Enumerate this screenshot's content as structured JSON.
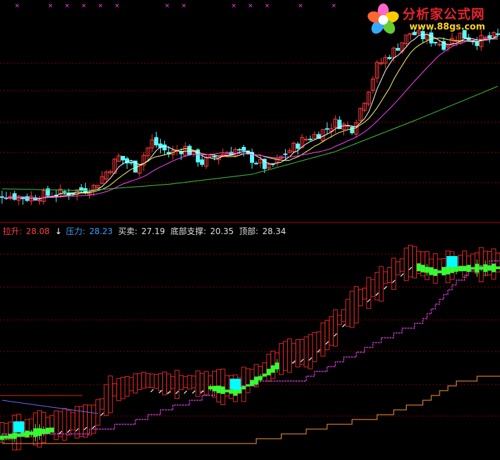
{
  "watermark": {
    "brand": "分析家公式网",
    "url": "www.88gs.com"
  },
  "indicator_legend": [
    {
      "label": "拉升:",
      "value": "28.08",
      "color": "#ff4040"
    },
    {
      "label": "压力:",
      "value": "28.23",
      "color": "#3aa0ff"
    },
    {
      "label": "买卖:",
      "value": "27.19",
      "color": "#e0e0e0"
    },
    {
      "label": "底部支撑:",
      "value": "20.35",
      "color": "#e0e0e0"
    },
    {
      "label": "顶部:",
      "value": "28.34",
      "color": "#e0e0e0"
    }
  ],
  "colors": {
    "background": "#000000",
    "grid": "#8b0000",
    "divider": "#c00000",
    "up_candle": "#ff3b3b",
    "down_candle": "#54ffff",
    "ma_short": "#ffffff",
    "ma_mid": "#ffff66",
    "ma_long": "#ff44ff",
    "ma_xlong": "#3cc83c",
    "band_red": "#e02828",
    "bull_block": "#33ff33",
    "cyan_block": "#00ffff",
    "support_line": "#e040e0",
    "bottom_line": "#ff9933",
    "marker_magenta": "#ff44ff"
  },
  "chart_data": [
    {
      "type": "candlestick",
      "title": "",
      "xlabel": "",
      "ylabel": "",
      "grid": true,
      "count": 120,
      "close_path": [
        [
          0,
          10.7
        ],
        [
          6,
          10.3
        ],
        [
          10,
          10.6
        ],
        [
          16,
          10.9
        ],
        [
          22,
          11.5
        ],
        [
          28,
          14.8
        ],
        [
          32,
          13.6
        ],
        [
          36,
          16.5
        ],
        [
          40,
          15.2
        ],
        [
          44,
          15.8
        ],
        [
          48,
          14.2
        ],
        [
          52,
          15.0
        ],
        [
          56,
          15.6
        ],
        [
          60,
          14.6
        ],
        [
          64,
          13.5
        ],
        [
          68,
          15.2
        ],
        [
          72,
          16.6
        ],
        [
          76,
          17.4
        ],
        [
          80,
          18.6
        ],
        [
          84,
          18.0
        ],
        [
          87,
          21.2
        ],
        [
          90,
          24.8
        ],
        [
          94,
          26.5
        ],
        [
          98,
          28.5
        ],
        [
          102,
          27.9
        ],
        [
          106,
          27.2
        ],
        [
          110,
          28.3
        ],
        [
          114,
          27.6
        ],
        [
          119,
          28.1
        ]
      ],
      "ma_long": [
        [
          0,
          11.3
        ],
        [
          20,
          11.1
        ],
        [
          40,
          11.8
        ],
        [
          60,
          12.9
        ],
        [
          80,
          15.4
        ],
        [
          100,
          19.0
        ],
        [
          119,
          22.6
        ]
      ]
    },
    {
      "type": "line",
      "title": "",
      "grid": true,
      "series": [
        {
          "name": "拉升",
          "points": [
            [
              0,
              10.4
            ],
            [
              12,
              11.2
            ],
            [
              22,
              11.9
            ],
            [
              26,
              14.6
            ],
            [
              34,
              15.8
            ],
            [
              40,
              15.5
            ],
            [
              50,
              15.6
            ],
            [
              56,
              15.1
            ],
            [
              62,
              16.6
            ],
            [
              68,
              18.5
            ],
            [
              74,
              19.0
            ],
            [
              80,
              21.5
            ],
            [
              86,
              24.4
            ],
            [
              92,
              26.4
            ],
            [
              98,
              28.4
            ],
            [
              104,
              27.6
            ],
            [
              110,
              28.0
            ],
            [
              119,
              28.08
            ]
          ]
        },
        {
          "name": "底部支撑",
          "points": [
            [
              0,
              10.2
            ],
            [
              20,
              10.2
            ],
            [
              30,
              11.0
            ],
            [
              40,
              12.6
            ],
            [
              50,
              14.2
            ],
            [
              62,
              15.4
            ],
            [
              72,
              15.6
            ],
            [
              82,
              17.8
            ],
            [
              92,
              20.0
            ],
            [
              100,
              21.5
            ],
            [
              108,
              25.5
            ],
            [
              114,
              27.5
            ],
            [
              119,
              28.0
            ]
          ]
        },
        {
          "name": "顶部",
          "points": [
            [
              0,
              9.2
            ],
            [
              60,
              9.2
            ],
            [
              70,
              10.0
            ],
            [
              80,
              11.0
            ],
            [
              90,
              11.8
            ],
            [
              100,
              13.2
            ],
            [
              110,
              15.6
            ],
            [
              119,
              16.0
            ]
          ]
        }
      ]
    }
  ]
}
